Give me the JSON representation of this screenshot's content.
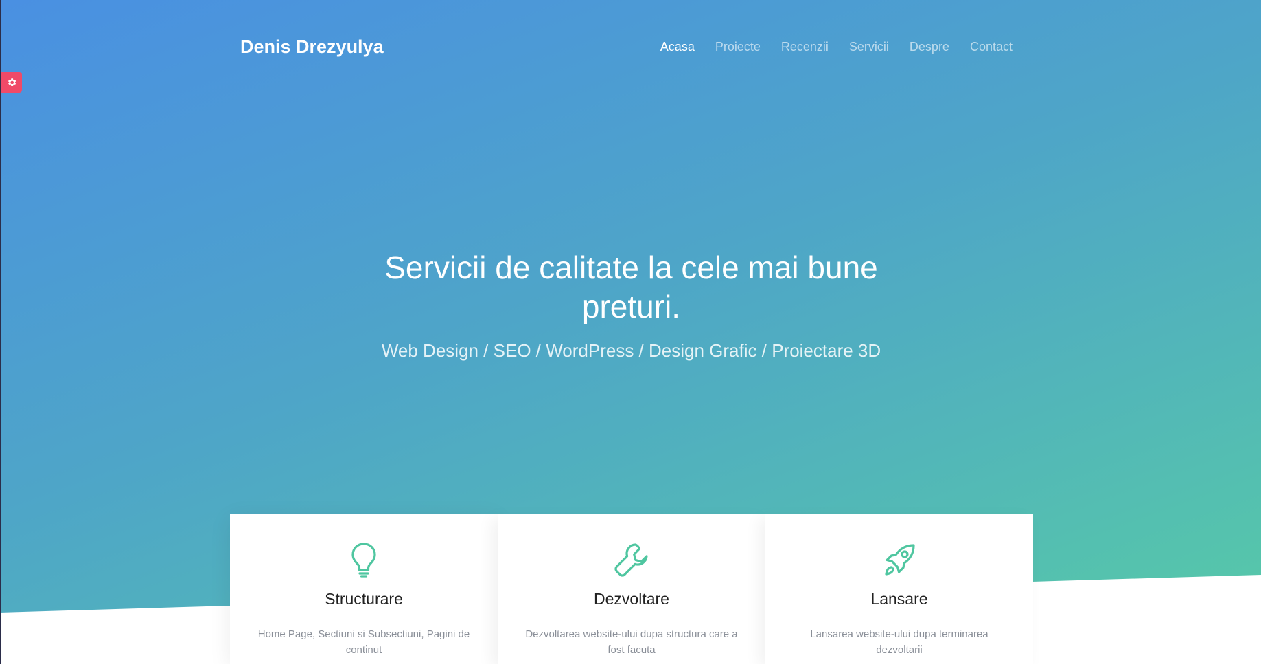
{
  "header": {
    "brand": "Denis Drezyulya",
    "nav": [
      {
        "label": "Acasa",
        "active": true
      },
      {
        "label": "Proiecte",
        "active": false
      },
      {
        "label": "Recenzii",
        "active": false
      },
      {
        "label": "Servicii",
        "active": false
      },
      {
        "label": "Despre",
        "active": false
      },
      {
        "label": "Contact",
        "active": false
      }
    ]
  },
  "settings": {
    "icon": "gear-icon",
    "color": "#f04a68"
  },
  "hero": {
    "headline": "Servicii de calitate la cele mai bune preturi.",
    "tagline": "Web Design / SEO / WordPress / Design Grafic / Proiectare 3D",
    "gradient": [
      "#4a90e2",
      "#57cba6"
    ]
  },
  "cards": [
    {
      "icon": "lightbulb-icon",
      "title": "Structurare",
      "text": "Home Page, Sectiuni si Subsectiuni, Pagini de continut"
    },
    {
      "icon": "wrench-icon",
      "title": "Dezvoltare",
      "text": "Dezvoltarea website-ului dupa structura care a fost facuta"
    },
    {
      "icon": "rocket-icon",
      "title": "Lansare",
      "text": "Lansarea website-ului dupa terminarea dezvoltarii"
    }
  ],
  "accent": "#4fc6a0"
}
